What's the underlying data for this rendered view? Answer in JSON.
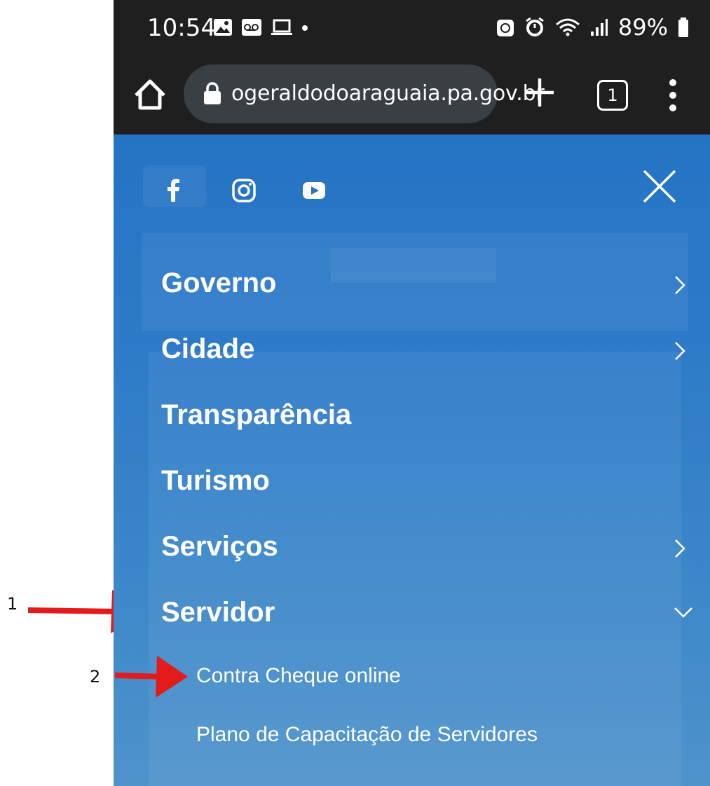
{
  "annotations": {
    "first": "1",
    "second": "2"
  },
  "status": {
    "time": "10:54",
    "battery": "89%"
  },
  "browser": {
    "url": "ogeraldodoaraguaia.pa.gov.br",
    "tab_count": "1"
  },
  "menu": {
    "items": [
      {
        "label": "Governo",
        "has_submenu": true
      },
      {
        "label": "Cidade",
        "has_submenu": true
      },
      {
        "label": "Transparência",
        "has_submenu": false
      },
      {
        "label": "Turismo",
        "has_submenu": false
      },
      {
        "label": "Serviços",
        "has_submenu": true
      },
      {
        "label": "Servidor",
        "expanded": true
      }
    ],
    "submenu": [
      "Contra Cheque online",
      "Plano de Capacitação de Servidores"
    ]
  },
  "icons": {
    "social": [
      "facebook-icon",
      "instagram-icon",
      "youtube-icon"
    ],
    "close": "close-icon"
  },
  "colors": {
    "overlay": "#2a73c5",
    "annotation_arrow": "#e31b1b",
    "status_bar": "#1f1f1f"
  }
}
